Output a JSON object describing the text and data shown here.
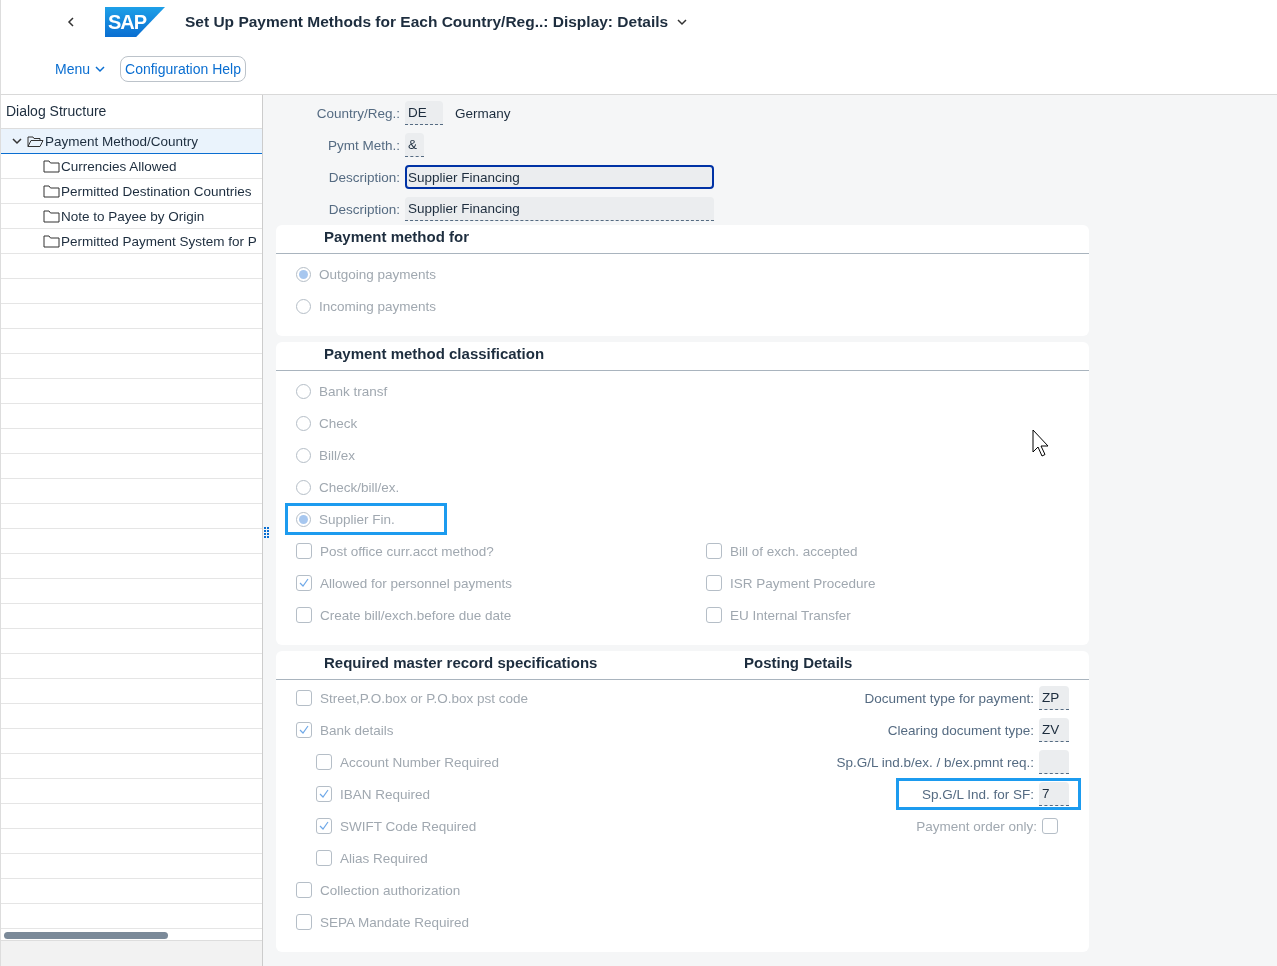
{
  "header": {
    "logo": "SAP",
    "title": "Set Up Payment Methods for Each Country/Reg..: Display: Details"
  },
  "toolbar": {
    "menu": "Menu",
    "help": "Configuration Help"
  },
  "dialog_structure": {
    "title": "Dialog Structure",
    "tree": [
      {
        "label": "Payment Method/Country",
        "expanded": true,
        "selected": true,
        "children": [
          {
            "label": "Currencies Allowed",
            "selected": false
          },
          {
            "label": "Permitted Destination Countries",
            "selected": false
          },
          {
            "label": "Note to Payee by Origin",
            "selected": false
          },
          {
            "label": "Permitted Payment System for P",
            "selected": false
          }
        ]
      }
    ]
  },
  "key_fields": [
    {
      "label": "Country/Reg.:",
      "value": "DE",
      "focused": false,
      "text": "Germany"
    },
    {
      "label": "Pymt Meth.:",
      "value": "&",
      "focused": false
    },
    {
      "label": "Description:",
      "value": "Supplier Financing",
      "focused": true
    },
    {
      "label": "Description:",
      "value": "Supplier Financing",
      "focused": false
    }
  ],
  "payment_method_for": {
    "title": "Payment method for",
    "options": [
      {
        "label": "Outgoing payments",
        "selected": true
      },
      {
        "label": "Incoming payments",
        "selected": false
      }
    ]
  },
  "classification": {
    "title": "Payment method classification",
    "options": [
      {
        "label": "Bank transf",
        "selected": false,
        "highlighted": false
      },
      {
        "label": "Check",
        "selected": false,
        "highlighted": false
      },
      {
        "label": "Bill/ex",
        "selected": false,
        "highlighted": false
      },
      {
        "label": "Check/bill/ex.",
        "selected": false,
        "highlighted": false
      },
      {
        "label": "Supplier Fin.",
        "selected": true,
        "highlighted": true
      }
    ],
    "checkboxes_left": [
      {
        "label": "Post office curr.acct method?",
        "checked": false
      },
      {
        "label": "Allowed for personnel payments",
        "checked": true
      },
      {
        "label": "Create bill/exch.before due date",
        "checked": false
      }
    ],
    "checkboxes_right": [
      {
        "label": "Bill of exch. accepted",
        "checked": false
      },
      {
        "label": "ISR Payment Procedure",
        "checked": false
      },
      {
        "label": "EU Internal Transfer",
        "checked": false
      }
    ]
  },
  "master_record": {
    "title": "Required master record specifications",
    "items": [
      {
        "label": "Street,P.O.box or P.O.box pst code",
        "checked": false
      },
      {
        "label": "Bank details",
        "checked": true,
        "children": [
          {
            "label": "Account Number Required",
            "checked": false
          },
          {
            "label": "IBAN Required",
            "checked": true
          },
          {
            "label": "SWIFT Code Required",
            "checked": true
          },
          {
            "label": "Alias Required",
            "checked": false
          }
        ]
      },
      {
        "label": "Collection authorization",
        "checked": false
      },
      {
        "label": "SEPA Mandate Required",
        "checked": false
      }
    ]
  },
  "posting_details": {
    "title": "Posting Details",
    "items": [
      {
        "kind": "field",
        "label": "Document type for payment:",
        "value": "ZP",
        "highlighted": false
      },
      {
        "kind": "field",
        "label": "Clearing document type:",
        "value": "ZV",
        "highlighted": false
      },
      {
        "kind": "field",
        "label": "Sp.G/L ind.b/ex. / b/ex.pmnt req.:",
        "value": null,
        "highlighted": false
      },
      {
        "kind": "field",
        "label": "Sp.G/L Ind. for SF:",
        "value": "7",
        "highlighted": true
      },
      {
        "kind": "checkbox",
        "label": "Payment order only:",
        "checked": false,
        "highlighted": false
      }
    ]
  }
}
